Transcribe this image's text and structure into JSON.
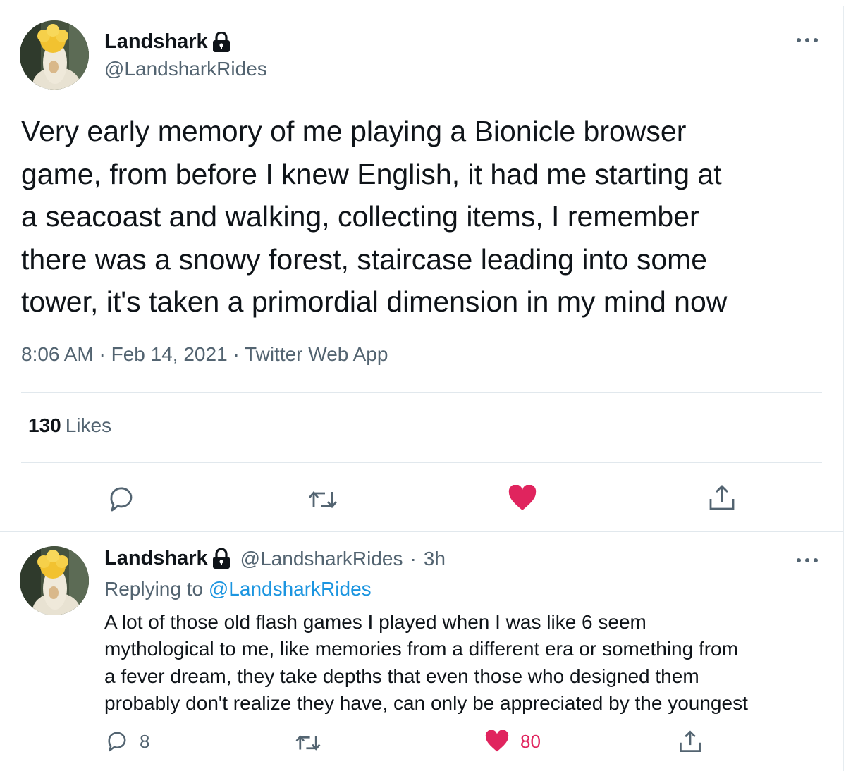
{
  "tweet": {
    "display_name": "Landshark",
    "handle": "@LandsharkRides",
    "text": "Very early memory of me playing a Bionicle browser\ngame, from before I knew English, it had me starting at\na seacoast and walking, collecting items, I remember\nthere was a snowy forest, staircase leading into some\ntower, it's taken a primordial dimension in my mind now",
    "time": "8:06 AM",
    "date": "Feb 14, 2021",
    "source": "Twitter Web App",
    "likes_count": "130",
    "likes_label": "Likes",
    "separator": "·"
  },
  "reply": {
    "display_name": "Landshark",
    "handle": "@LandsharkRides",
    "separator": "·",
    "time_ago": "3h",
    "replying_prefix": "Replying to",
    "replying_to": "@LandsharkRides",
    "text": "A lot of those old flash games I played when I was like 6 seem\nmythological to me, like memories from a different era or something from\na fever dream, they take depths that even those who designed them\nprobably don't realize they have, can only be appreciated by the youngest",
    "reply_count": "8",
    "like_count": "80"
  },
  "icons": {
    "more": "more-icon",
    "lock": "lock-icon",
    "reply": "reply-icon",
    "retweet": "retweet-icon",
    "like": "heart-icon",
    "share": "share-icon"
  },
  "colors": {
    "like_active": "#e0245e",
    "link": "#1b95e0",
    "secondary_text": "#536471"
  }
}
